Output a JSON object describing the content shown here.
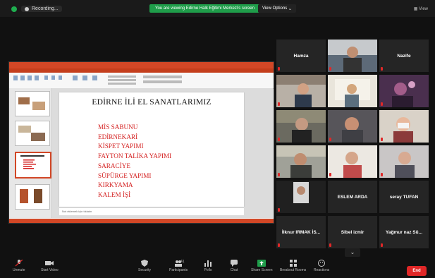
{
  "topbar": {
    "recording_label": "Recording...",
    "share_banner": "You are viewing Edirne Halk Eğitimi Merkezi's screen",
    "view_options": "View Options",
    "view_button": "View"
  },
  "slide": {
    "title": "EDİRNE İLİ EL SANATLARIMIZ",
    "items": [
      "MİS SABUNU",
      "EDİRNEKARİ",
      "KİSPET YAPIMI",
      "FAYTON TALİKA YAPIMI",
      "SARACİYE",
      "SÜPÜRGE YAPIMI",
      "KIRKYAMA",
      "KALEM İŞİ"
    ],
    "notes_placeholder": "Not eklemek için tıklatın"
  },
  "participants": [
    {
      "name": "Hamza",
      "kind": "name"
    },
    {
      "name": "",
      "kind": "video"
    },
    {
      "name": "Nazife",
      "kind": "name"
    },
    {
      "name": "",
      "kind": "video"
    },
    {
      "name": "",
      "kind": "video",
      "active": true
    },
    {
      "name": "",
      "kind": "video"
    },
    {
      "name": "",
      "kind": "video"
    },
    {
      "name": "",
      "kind": "video"
    },
    {
      "name": "",
      "kind": "video"
    },
    {
      "name": "",
      "kind": "video"
    },
    {
      "name": "",
      "kind": "video"
    },
    {
      "name": "",
      "kind": "video"
    },
    {
      "name": "",
      "kind": "video"
    },
    {
      "name": "ESLEM ARDA",
      "kind": "name"
    },
    {
      "name": "seray TUFAN",
      "kind": "name"
    },
    {
      "name": "İlknur IRMAK İS...",
      "kind": "name"
    },
    {
      "name": "Sibel izmir",
      "kind": "name"
    },
    {
      "name": "Yağmur naz Sü...",
      "kind": "name"
    }
  ],
  "controls": {
    "unmute": "Unmute",
    "start_video": "Start Video",
    "security": "Security",
    "participants": "Participants",
    "participants_count": "41",
    "polls": "Polls",
    "chat": "Chat",
    "share_screen": "Share Screen",
    "breakout_rooms": "Breakout Rooms",
    "reactions": "Reactions",
    "end": "End"
  },
  "colors": {
    "share_green": "#1f9d4a",
    "slide_text_red": "#d42020",
    "end_red": "#e02727",
    "active_speaker": "#cfe44a"
  }
}
